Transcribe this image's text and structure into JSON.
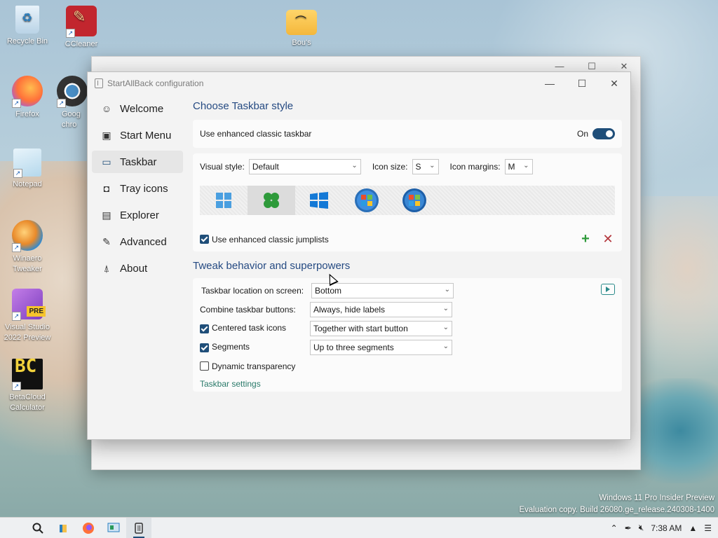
{
  "desktop": {
    "icons": [
      {
        "label": "Recycle Bin"
      },
      {
        "label": "CCleaner"
      },
      {
        "label": "Bou's"
      },
      {
        "label": "Firefox"
      },
      {
        "label": "Goog chro"
      },
      {
        "label": "Notepad"
      },
      {
        "label": "Winaero Tweaker"
      },
      {
        "label": "Visual Studio 2022 Preview",
        "badge": "PRE"
      },
      {
        "label": "BetaCloud Calculator",
        "glyph": "BC"
      }
    ],
    "watermark": {
      "line1": "Windows 11 Pro Insider Preview",
      "line2": "Evaluation copy. Build 26080.ge_release.240308-1400"
    }
  },
  "window": {
    "title": "StartAllBack configuration",
    "controls": {
      "minimize": "—",
      "maximize": "☐",
      "close": "✕"
    }
  },
  "sidebar": {
    "items": [
      {
        "label": "Welcome",
        "icon": "smile-icon",
        "glyph": "☺"
      },
      {
        "label": "Start Menu",
        "icon": "start-menu-icon",
        "glyph": "▣"
      },
      {
        "label": "Taskbar",
        "icon": "taskbar-icon",
        "glyph": "▭",
        "active": true
      },
      {
        "label": "Tray icons",
        "icon": "tray-icon",
        "glyph": "◘"
      },
      {
        "label": "Explorer",
        "icon": "folder-icon",
        "glyph": "▤"
      },
      {
        "label": "Advanced",
        "icon": "wrench-icon",
        "glyph": "✎"
      },
      {
        "label": "About",
        "icon": "info-icon",
        "glyph": "⍋"
      }
    ]
  },
  "taskbar_style": {
    "heading": "Choose Taskbar style",
    "enhanced_label": "Use enhanced classic taskbar",
    "enhanced_state": "On",
    "visual_style_label": "Visual style:",
    "visual_style_value": "Default",
    "icon_size_label": "Icon size:",
    "icon_size_value": "S",
    "icon_margins_label": "Icon margins:",
    "icon_margins_value": "M",
    "jumplists_label": "Use enhanced classic jumplists",
    "jumplists_checked": true,
    "style_icons": [
      "windows11-logo-icon",
      "clover-logo-icon",
      "windows10-logo-icon",
      "windows7-orb-icon",
      "windows-vista-orb-icon"
    ],
    "selected_style_index": 1
  },
  "tweak": {
    "heading": "Tweak behavior and superpowers",
    "rows": [
      {
        "label": "Taskbar location on screen:",
        "value": "Bottom",
        "checkbox": null
      },
      {
        "label": "Combine taskbar buttons:",
        "value": "Always, hide labels",
        "checkbox": null
      },
      {
        "label": "Centered task icons",
        "value": "Together with start button",
        "checkbox": true
      },
      {
        "label": "Segments",
        "value": "Up to three segments",
        "checkbox": true
      },
      {
        "label": "Dynamic transparency",
        "value": null,
        "checkbox": false
      }
    ],
    "settings_link": "Taskbar settings"
  },
  "taskbar": {
    "items": [
      "search-icon",
      "file-explorer-icon",
      "firefox-icon",
      "control-panel-icon",
      "startallback-icon"
    ],
    "tray": {
      "clock": "7:38 AM"
    }
  },
  "colors": {
    "accent": "#1f4e79",
    "heading": "#254a82",
    "link": "#2a7a6a",
    "add": "#2e9a3a",
    "remove": "#b3353b"
  }
}
